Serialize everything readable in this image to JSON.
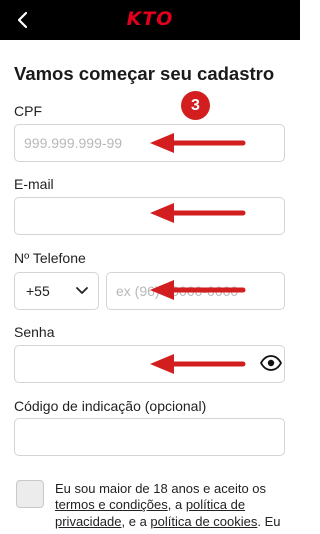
{
  "header": {
    "back_icon": "chevron-left-icon",
    "logo_text": "KTO",
    "brand_color": "#e0001b",
    "background_color": "#000000"
  },
  "page": {
    "title": "Vamos começar seu cadastro"
  },
  "form": {
    "cpf": {
      "label": "CPF",
      "placeholder": "999.999.999-99",
      "value": ""
    },
    "email": {
      "label": "E-mail",
      "placeholder": "",
      "value": ""
    },
    "phone": {
      "label": "Nº Telefone",
      "country_code": "+55",
      "country_icon": "chevron-down-icon",
      "placeholder": "ex (96) 00000-0000",
      "value": ""
    },
    "password": {
      "label": "Senha",
      "placeholder": "",
      "value": "",
      "toggle_icon": "eye-icon"
    },
    "referral": {
      "label": "Código de indicação (opcional)",
      "placeholder": "",
      "value": ""
    }
  },
  "terms": {
    "checked": false,
    "text_1": "Eu sou maior de 18 anos e aceito os",
    "link_terms": "termos e condições",
    "text_2": ", a",
    "link_privacy": "política de privacidade",
    "text_3": ", e a",
    "link_cookies": "política de cookies",
    "text_4": ". Eu"
  },
  "annotations": {
    "step_badge": "3",
    "badge_color": "#d21e1e",
    "arrow_color": "#d21e1e"
  }
}
